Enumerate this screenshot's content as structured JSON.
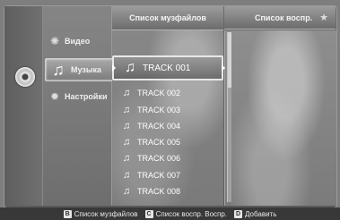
{
  "categories": [
    {
      "label": "Видео",
      "icon": "film-reel-icon"
    },
    {
      "label": "Музыка",
      "icon": "music-note-icon"
    },
    {
      "label": "Настройки",
      "icon": "gear-icon"
    }
  ],
  "headers": {
    "files": "Список музфайлов",
    "playlist": "Список воспр."
  },
  "tracks": [
    "TRACK 001",
    "TRACK 002",
    "TRACK 003",
    "TRACK 004",
    "TRACK 005",
    "TRACK 006",
    "TRACK 007",
    "TRACK 008"
  ],
  "selected_track_index": 0,
  "bottom_hints": [
    {
      "key": "B",
      "label": "Список музфайлов"
    },
    {
      "key": "C",
      "label": "Список воспр. Воспр."
    },
    {
      "key": "D",
      "label": "Добавить"
    }
  ]
}
